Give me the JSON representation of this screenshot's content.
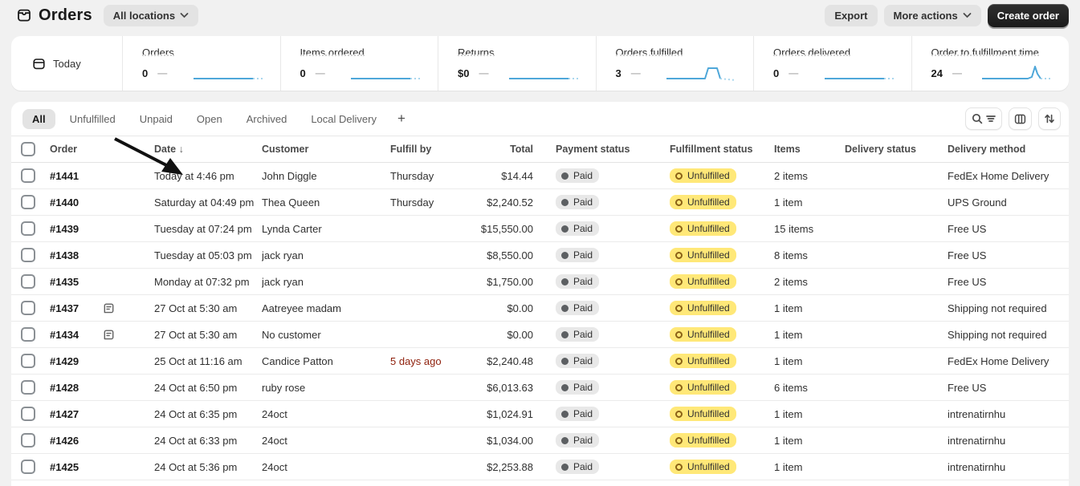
{
  "header": {
    "title": "Orders",
    "location_filter": "All locations",
    "export_label": "Export",
    "more_actions_label": "More actions",
    "create_order_label": "Create order"
  },
  "metrics": {
    "date_range": "Today",
    "dash": "—",
    "items": [
      {
        "label": "Orders",
        "value": "0",
        "sparkline": "flat"
      },
      {
        "label": "Items ordered",
        "value": "0",
        "sparkline": "flat"
      },
      {
        "label": "Returns",
        "value": "$0",
        "sparkline": "flat"
      },
      {
        "label": "Orders fulfilled",
        "value": "3",
        "sparkline": "bump"
      },
      {
        "label": "Orders delivered",
        "value": "0",
        "sparkline": "flat"
      },
      {
        "label": "Order to fulfillment time",
        "value": "24",
        "sparkline": "spike"
      }
    ]
  },
  "views": {
    "tabs": [
      "All",
      "Unfulfilled",
      "Unpaid",
      "Open",
      "Archived",
      "Local Delivery"
    ],
    "active_tab": "All",
    "add_view_label": "+"
  },
  "table": {
    "columns": [
      "Order",
      "Date",
      "Customer",
      "Fulfill by",
      "Total",
      "Payment status",
      "Fulfillment status",
      "Items",
      "Delivery status",
      "Delivery method"
    ],
    "sort_indicator": "↓",
    "rows": [
      {
        "order": "#1441",
        "has_note": false,
        "date": "Today at 4:46 pm",
        "customer": "John Diggle",
        "fulfill_by": "Thursday",
        "fulfill_by_alert": false,
        "total": "$14.44",
        "payment_status": "Paid",
        "fulfillment_status": "Unfulfilled",
        "items": "2 items",
        "delivery_status": "",
        "delivery_method": "FedEx Home Delivery"
      },
      {
        "order": "#1440",
        "has_note": false,
        "date": "Saturday at 04:49 pm",
        "customer": "Thea Queen",
        "fulfill_by": "Thursday",
        "fulfill_by_alert": false,
        "total": "$2,240.52",
        "payment_status": "Paid",
        "fulfillment_status": "Unfulfilled",
        "items": "1 item",
        "delivery_status": "",
        "delivery_method": "UPS Ground"
      },
      {
        "order": "#1439",
        "has_note": false,
        "date": "Tuesday at 07:24 pm",
        "customer": "Lynda Carter",
        "fulfill_by": "",
        "fulfill_by_alert": false,
        "total": "$15,550.00",
        "payment_status": "Paid",
        "fulfillment_status": "Unfulfilled",
        "items": "15 items",
        "delivery_status": "",
        "delivery_method": "Free US"
      },
      {
        "order": "#1438",
        "has_note": false,
        "date": "Tuesday at 05:03 pm",
        "customer": "jack ryan",
        "fulfill_by": "",
        "fulfill_by_alert": false,
        "total": "$8,550.00",
        "payment_status": "Paid",
        "fulfillment_status": "Unfulfilled",
        "items": "8 items",
        "delivery_status": "",
        "delivery_method": "Free US"
      },
      {
        "order": "#1435",
        "has_note": false,
        "date": "Monday at 07:32 pm",
        "customer": "jack ryan",
        "fulfill_by": "",
        "fulfill_by_alert": false,
        "total": "$1,750.00",
        "payment_status": "Paid",
        "fulfillment_status": "Unfulfilled",
        "items": "2 items",
        "delivery_status": "",
        "delivery_method": "Free US"
      },
      {
        "order": "#1437",
        "has_note": true,
        "date": "27 Oct at 5:30 am",
        "customer": "Aatreyee madam",
        "fulfill_by": "",
        "fulfill_by_alert": false,
        "total": "$0.00",
        "payment_status": "Paid",
        "fulfillment_status": "Unfulfilled",
        "items": "1 item",
        "delivery_status": "",
        "delivery_method": "Shipping not required"
      },
      {
        "order": "#1434",
        "has_note": true,
        "date": "27 Oct at 5:30 am",
        "customer": "No customer",
        "fulfill_by": "",
        "fulfill_by_alert": false,
        "total": "$0.00",
        "payment_status": "Paid",
        "fulfillment_status": "Unfulfilled",
        "items": "1 item",
        "delivery_status": "",
        "delivery_method": "Shipping not required"
      },
      {
        "order": "#1429",
        "has_note": false,
        "date": "25 Oct at 11:16 am",
        "customer": "Candice Patton",
        "fulfill_by": "5 days ago",
        "fulfill_by_alert": true,
        "total": "$2,240.48",
        "payment_status": "Paid",
        "fulfillment_status": "Unfulfilled",
        "items": "1 item",
        "delivery_status": "",
        "delivery_method": "FedEx Home Delivery"
      },
      {
        "order": "#1428",
        "has_note": false,
        "date": "24 Oct at 6:50 pm",
        "customer": "ruby rose",
        "fulfill_by": "",
        "fulfill_by_alert": false,
        "total": "$6,013.63",
        "payment_status": "Paid",
        "fulfillment_status": "Unfulfilled",
        "items": "6 items",
        "delivery_status": "",
        "delivery_method": "Free US"
      },
      {
        "order": "#1427",
        "has_note": false,
        "date": "24 Oct at 6:35 pm",
        "customer": "24oct",
        "fulfill_by": "",
        "fulfill_by_alert": false,
        "total": "$1,024.91",
        "payment_status": "Paid",
        "fulfillment_status": "Unfulfilled",
        "items": "1 item",
        "delivery_status": "",
        "delivery_method": "intrenatirnhu"
      },
      {
        "order": "#1426",
        "has_note": false,
        "date": "24 Oct at 6:33 pm",
        "customer": "24oct",
        "fulfill_by": "",
        "fulfill_by_alert": false,
        "total": "$1,034.00",
        "payment_status": "Paid",
        "fulfillment_status": "Unfulfilled",
        "items": "1 item",
        "delivery_status": "",
        "delivery_method": "intrenatirnhu"
      },
      {
        "order": "#1425",
        "has_note": false,
        "date": "24 Oct at 5:36 pm",
        "customer": "24oct",
        "fulfill_by": "",
        "fulfill_by_alert": false,
        "total": "$2,253.88",
        "payment_status": "Paid",
        "fulfillment_status": "Unfulfilled",
        "items": "1 item",
        "delivery_status": "",
        "delivery_method": "intrenatirnhu"
      }
    ]
  },
  "colors": {
    "accent_spark": "#4ea7d9",
    "spark_tail": "#a9d7ee",
    "badge_yellow": "#ffe878",
    "badge_gray": "#e8e8e8",
    "critical_text": "#8e1f0b",
    "primary_button": "#1a1a1a",
    "page_bg": "#f1f1f1"
  }
}
